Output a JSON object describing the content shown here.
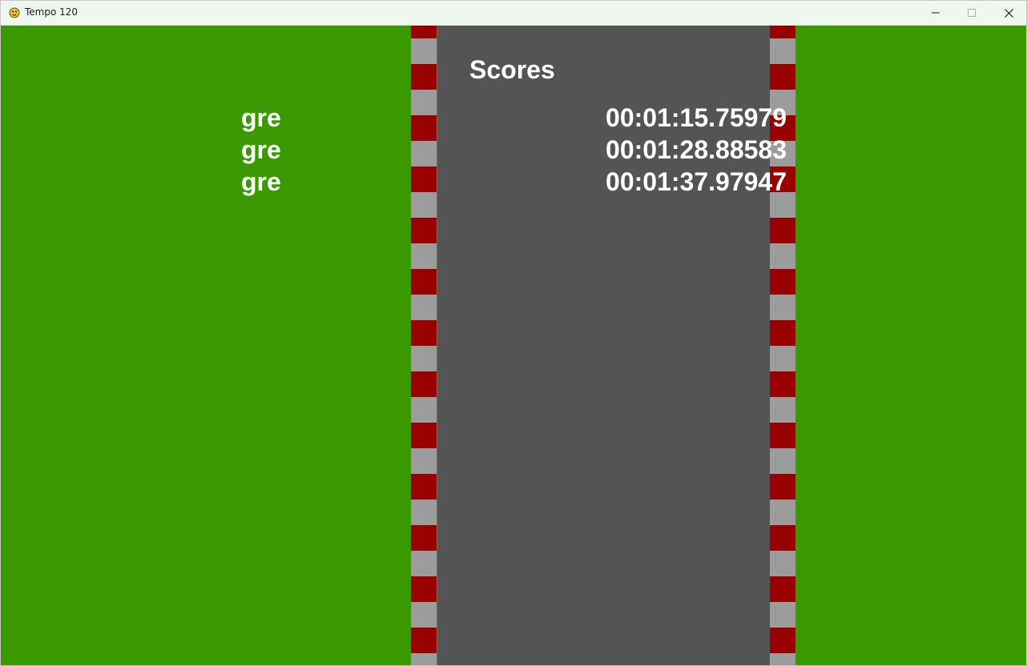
{
  "window": {
    "title": "Tempo 120"
  },
  "game": {
    "scores_title": "Scores",
    "scores": [
      {
        "name": "gre",
        "time": "00:01:15.75979"
      },
      {
        "name": "gre",
        "time": "00:01:28.88583"
      },
      {
        "name": "gre",
        "time": "00:01:37.97947"
      }
    ]
  },
  "colors": {
    "grass": "#3a9900",
    "road": "#545454",
    "curb_red": "#990000",
    "curb_grey": "#9c9c9c",
    "text": "#ffffff"
  },
  "icons": {
    "app": "pygame-snake-icon",
    "minimize": "minimize-icon",
    "maximize": "maximize-icon",
    "close": "close-icon"
  }
}
